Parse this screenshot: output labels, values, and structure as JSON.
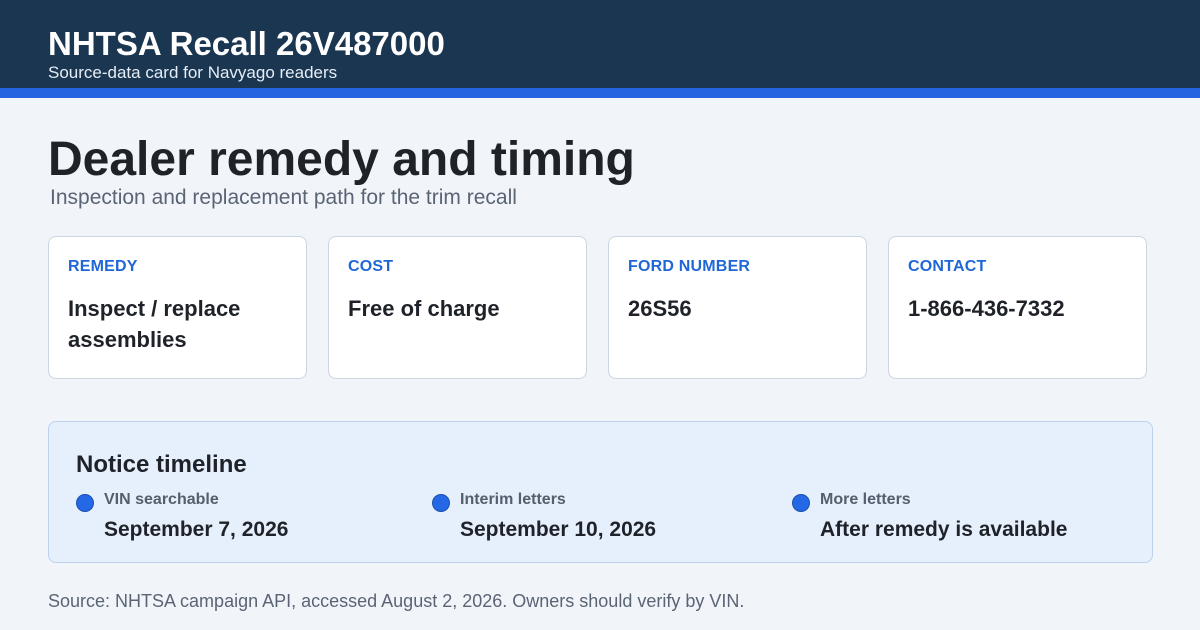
{
  "header": {
    "title": "NHTSA Recall 26V487000",
    "subtitle": "Source-data card for Navyago readers"
  },
  "main": {
    "title": "Dealer remedy and timing",
    "subtitle": "Inspection and replacement path for the trim recall"
  },
  "cards": [
    {
      "label": "REMEDY",
      "value": "Inspect / replace assemblies"
    },
    {
      "label": "COST",
      "value": "Free of charge"
    },
    {
      "label": "FORD NUMBER",
      "value": "26S56"
    },
    {
      "label": "CONTACT",
      "value": "1-866-436-7332"
    }
  ],
  "timeline": {
    "title": "Notice timeline",
    "items": [
      {
        "label": "VIN searchable",
        "value": "September 7, 2026"
      },
      {
        "label": "Interim letters",
        "value": "September 10, 2026"
      },
      {
        "label": "More letters",
        "value": "After remedy is available"
      }
    ]
  },
  "footer": {
    "source": "Source: NHTSA campaign API, accessed August 2, 2026. Owners should verify by VIN."
  },
  "colors": {
    "header_bg": "#1b3651",
    "accent": "#2464e0",
    "label_blue": "#1f66d6",
    "page_bg": "#f1f5fa",
    "timeline_bg": "#e6f0fc"
  }
}
